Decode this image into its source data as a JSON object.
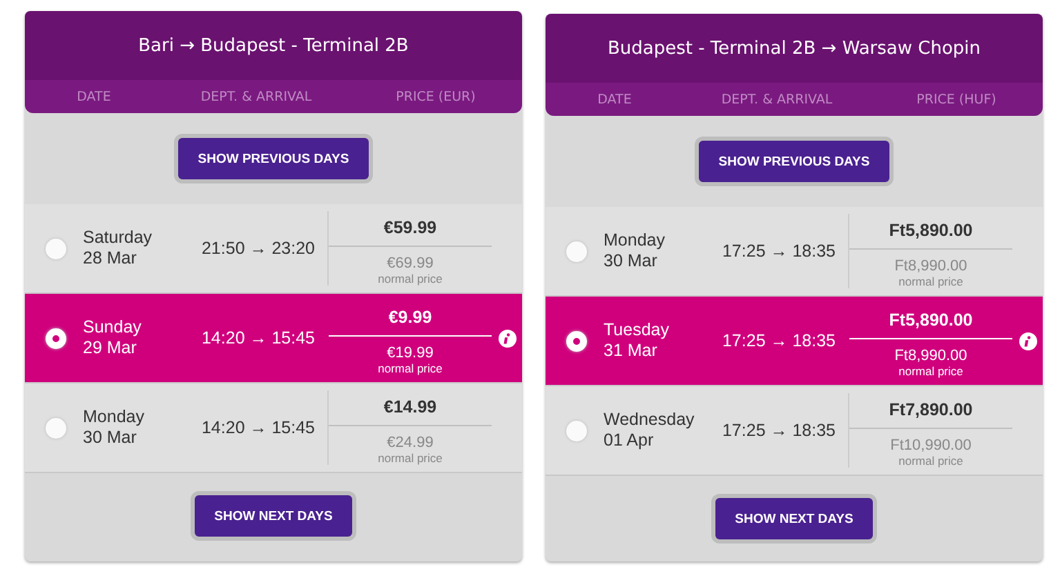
{
  "panels": [
    {
      "title": "Bari → Budapest - Terminal 2B",
      "columns": [
        "DATE",
        "DEPT. & ARRIVAL",
        "PRICE (EUR)"
      ],
      "previous_button": "SHOW PREVIOUS DAYS",
      "next_button": "SHOW NEXT DAYS",
      "rows": [
        {
          "day": "Saturday",
          "date": "28 Mar",
          "times": "21:50 → 23:20",
          "price": "€59.99",
          "normal": "€69.99",
          "normal_label": "normal price",
          "selected": false,
          "info": false
        },
        {
          "day": "Sunday",
          "date": "29 Mar",
          "times": "14:20 → 15:45",
          "price": "€9.99",
          "normal": "€19.99",
          "normal_label": "normal price",
          "selected": true,
          "info": true
        },
        {
          "day": "Monday",
          "date": "30 Mar",
          "times": "14:20 → 15:45",
          "price": "€14.99",
          "normal": "€24.99",
          "normal_label": "normal price",
          "selected": false,
          "info": false
        }
      ]
    },
    {
      "title": "Budapest - Terminal 2B → Warsaw Chopin",
      "columns": [
        "DATE",
        "DEPT. & ARRIVAL",
        "PRICE (HUF)"
      ],
      "previous_button": "SHOW PREVIOUS DAYS",
      "next_button": "SHOW NEXT DAYS",
      "rows": [
        {
          "day": "Monday",
          "date": "30 Mar",
          "times": "17:25 → 18:35",
          "price": "Ft5,890.00",
          "normal": "Ft8,990.00",
          "normal_label": "normal price",
          "selected": false,
          "info": false
        },
        {
          "day": "Tuesday",
          "date": "31 Mar",
          "times": "17:25 → 18:35",
          "price": "Ft5,890.00",
          "normal": "Ft8,990.00",
          "normal_label": "normal price",
          "selected": true,
          "info": true
        },
        {
          "day": "Wednesday",
          "date": "01 Apr",
          "times": "17:25 → 18:35",
          "price": "Ft7,890.00",
          "normal": "Ft10,990.00",
          "normal_label": "normal price",
          "selected": false,
          "info": false
        }
      ]
    }
  ]
}
